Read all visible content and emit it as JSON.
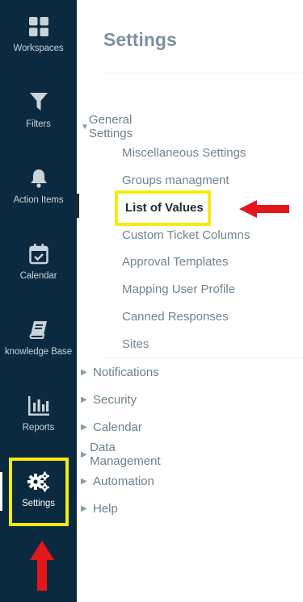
{
  "nav": {
    "items": [
      {
        "label": "Workspaces",
        "icon": "workspaces-icon"
      },
      {
        "label": "Filters",
        "icon": "filter-icon"
      },
      {
        "label": "Action Items",
        "icon": "bell-icon"
      },
      {
        "label": "Calendar",
        "icon": "calendar-check-icon"
      },
      {
        "label": "knowledge Base",
        "icon": "book-icon"
      },
      {
        "label": "Reports",
        "icon": "bar-chart-icon"
      },
      {
        "label": "Settings",
        "icon": "gears-icon"
      }
    ]
  },
  "main": {
    "title": "Settings",
    "tree": {
      "general": {
        "label": "General Settings",
        "expanded": true,
        "items": [
          "Miscellaneous Settings",
          "Groups managment",
          "List of Values",
          "Custom Ticket Columns",
          "Approval Templates",
          "Mapping User Profile",
          "Canned Responses",
          "Sites"
        ]
      },
      "groups": [
        "Notifications",
        "Security",
        "Calendar",
        "Data Management",
        "Automation",
        "Help"
      ]
    }
  },
  "colors": {
    "nav_bg": "#0b2a3f",
    "highlight": "#f5ea14",
    "annotation_arrow": "#e3161b"
  }
}
